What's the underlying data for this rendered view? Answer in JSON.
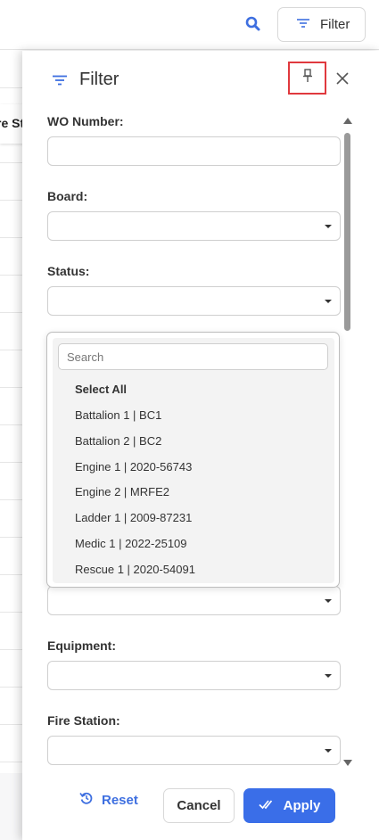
{
  "topbar": {
    "search_icon": "search-icon",
    "filter_button_label": "Filter",
    "filter_icon": "filter-lines-icon"
  },
  "background": {
    "header_fragment": "re St"
  },
  "panel": {
    "title": "Filter",
    "title_icon": "filter-lines-icon",
    "pin_icon": "pin-icon",
    "close_icon": "close-icon",
    "fields": {
      "wo_number": {
        "label": "WO Number:",
        "value": ""
      },
      "board": {
        "label": "Board:",
        "value": ""
      },
      "status": {
        "label": "Status:",
        "value": ""
      },
      "equipment": {
        "label": "Equipment:",
        "value": ""
      },
      "fire_station": {
        "label": "Fire Station:",
        "value": ""
      }
    },
    "dropdown": {
      "search_placeholder": "Search",
      "options": [
        "Select All",
        "Battalion 1 | BC1",
        "Battalion 2 | BC2",
        "Engine 1 | 2020-56743",
        "Engine 2 | MRFE2",
        "Ladder 1 | 2009-87231",
        "Medic 1 | 2022-25109",
        "Rescue 1 | 2020-54091"
      ]
    },
    "footer": {
      "reset_label": "Reset",
      "cancel_label": "Cancel",
      "apply_label": "Apply"
    }
  },
  "colors": {
    "accent": "#3a6ee8",
    "highlight_border": "#e0393e"
  }
}
